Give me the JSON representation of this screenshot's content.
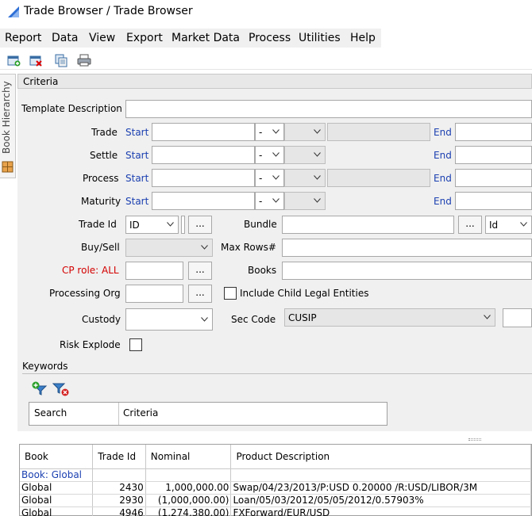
{
  "window": {
    "title": "Trade Browser / Trade Browser"
  },
  "menu": [
    "Report",
    "Data",
    "View",
    "Export",
    "Market Data",
    "Process",
    "Utilities",
    "Help"
  ],
  "toolbar": {
    "buttons": [
      "new-trade-icon",
      "delete-trade-icon",
      "copy-icon",
      "print-icon"
    ]
  },
  "side_tab": {
    "label": "Book Hierarchy"
  },
  "criteria": {
    "header": "Criteria",
    "template_description_label": "Template Description",
    "start_label": "Start",
    "end_label": "End",
    "minus_value": "-",
    "date_rows": [
      {
        "label": "Trade"
      },
      {
        "label": "Settle"
      },
      {
        "label": "Process"
      },
      {
        "label": "Maturity"
      }
    ],
    "trade_id_label": "Trade Id",
    "trade_id_type": "ID",
    "bundle_label": "Bundle",
    "bundle_type": "Id",
    "buy_sell_label": "Buy/Sell",
    "max_rows_label": "Max Rows#",
    "cp_role_label": "CP role: ALL",
    "books_label": "Books",
    "processing_org_label": "Processing Org",
    "include_child_label": "Include Child Legal Entities",
    "custody_label": "Custody",
    "sec_code_label": "Sec Code",
    "sec_code_value": "CUSIP",
    "risk_explode_label": "Risk Explode",
    "dots": "..."
  },
  "keywords": {
    "label": "Keywords",
    "columns": [
      "Search",
      "Criteria"
    ]
  },
  "results": {
    "columns": [
      "Book",
      "Trade Id",
      "Nominal",
      "Product Description"
    ],
    "group_row": "Book: Global",
    "rows": [
      {
        "book": "Global",
        "trade_id": "2430",
        "nominal": "1,000,000.00",
        "description": "Swap/04/23/2013/P:USD 0.20000 /R:USD/LIBOR/3M"
      },
      {
        "book": "Global",
        "trade_id": "2930",
        "nominal": "(1,000,000.00)",
        "description": "Loan/05/03/2012/05/05/2012/0.57903%"
      },
      {
        "book": "Global",
        "trade_id": "4946",
        "nominal": "(1,274,380.00)",
        "description": "FXForward/EUR/USD"
      }
    ]
  }
}
